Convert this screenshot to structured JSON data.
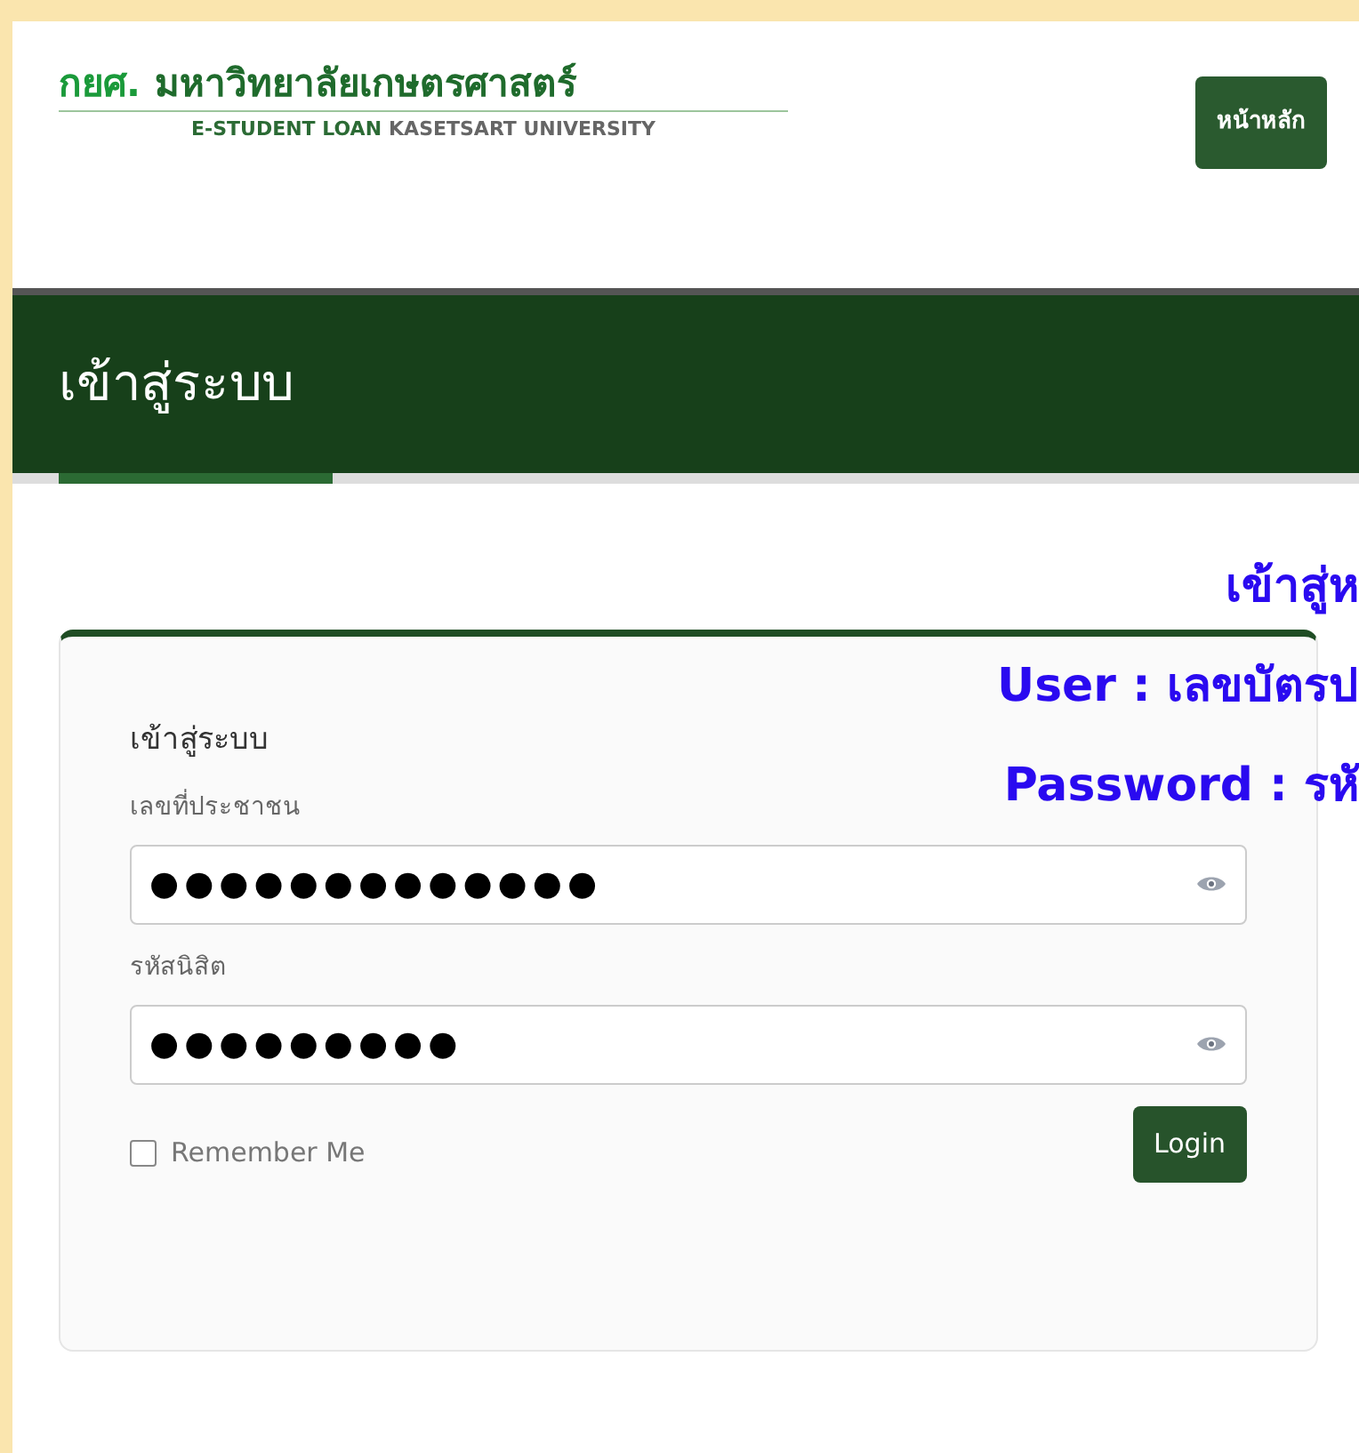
{
  "logo": {
    "title_thai_abbr": "กยศ.",
    "title_thai": "มหาวิทยาลัยเกษตรศาสตร์",
    "subtitle_bold": "E-STUDENT LOAN",
    "subtitle": "KASETSART UNIVERSITY"
  },
  "nav": [
    {
      "label": "หน้าหลัก",
      "selected": true
    }
  ],
  "page_title": "เข้าสู่ระบบ",
  "overlay_lines": [
    "เข้าสู่ห",
    "User : เลขบัตรป",
    "Password : รหั"
  ],
  "form": {
    "title": "เข้าสู่ระบบ",
    "fields": [
      {
        "label": "เลขที่ประชาชน",
        "value": "●●●●●●●●●●●●●"
      },
      {
        "label": "รหัสนิสิต",
        "value": "●●●●●●●●●"
      }
    ],
    "remember": {
      "label": "Remember Me",
      "checked": false
    },
    "submit": "Login"
  }
}
